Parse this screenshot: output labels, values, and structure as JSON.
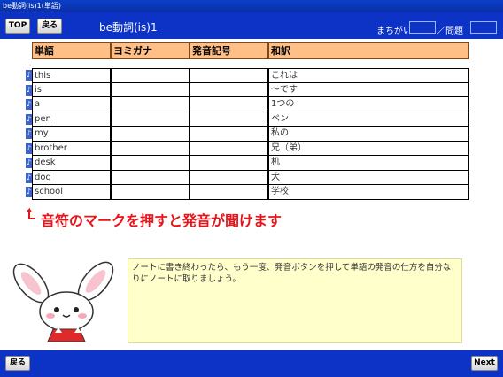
{
  "window_title": "be動詞(is)1(単語)",
  "toolbar": {
    "top_label": "TOP",
    "back_label": "戻る",
    "title": "be動詞(is)1"
  },
  "stats": {
    "mistakes_label": "まちがい",
    "questions_label": "／問題"
  },
  "table": {
    "headers": [
      "単語",
      "ヨミガナ",
      "発音記号",
      "和訳"
    ],
    "rows": [
      {
        "word": "this",
        "reading": "",
        "phonetic": "",
        "meaning": "これは"
      },
      {
        "word": "is",
        "reading": "",
        "phonetic": "",
        "meaning": "〜です"
      },
      {
        "word": "a",
        "reading": "",
        "phonetic": "",
        "meaning": "1つの"
      },
      {
        "word": "pen",
        "reading": "",
        "phonetic": "",
        "meaning": "ペン"
      },
      {
        "word": "my",
        "reading": "",
        "phonetic": "",
        "meaning": "私の"
      },
      {
        "word": "brother",
        "reading": "",
        "phonetic": "",
        "meaning": "兄（弟）"
      },
      {
        "word": "desk",
        "reading": "",
        "phonetic": "",
        "meaning": "机"
      },
      {
        "word": "dog",
        "reading": "",
        "phonetic": "",
        "meaning": "犬"
      },
      {
        "word": "school",
        "reading": "",
        "phonetic": "",
        "meaning": "学校"
      }
    ]
  },
  "hint": "音符のマークを押すと発音が聞けます",
  "note": "ノートに書き終わったら、もう一度、発音ボタンを押して単語の発音の仕方を自分なりにノートに取りましょう。",
  "bottom": {
    "back_label": "戻る",
    "next_label": "Next"
  },
  "colors": {
    "bar_blue": "#0c33c6",
    "header_orange": "#ffbf86",
    "hint_red": "#e8141a",
    "note_yellow": "#ffffcc"
  },
  "icons": [
    "music-note-icon",
    "up-arrow-icon",
    "rabbit-mascot"
  ]
}
